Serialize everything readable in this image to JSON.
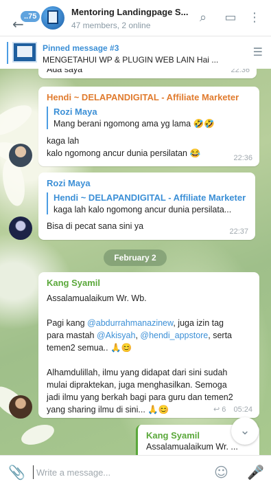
{
  "header": {
    "unread_badge": "..75",
    "title": "Mentoring Landingpage S...",
    "subtitle": "47 members, 2 online"
  },
  "pinned": {
    "title": "Pinned message #3",
    "text": "MENGETAHUI WP & PLUGIN WEB LAIN  Hai ..."
  },
  "messages": [
    {
      "partial_text": "Ada saya",
      "time": "22:36"
    },
    {
      "sender": "Hendi ~ DELAPANDIGITAL - Affiliate Marketer",
      "sender_color": "#e07b2e",
      "quote_name": "Rozi Maya",
      "quote_text": "Mang berani ngomong ama yg lama 🤣🤣",
      "text_line1": "kaga lah",
      "text_line2": "kalo ngomong ancur dunia persilatan 😂",
      "time": "22:36"
    },
    {
      "sender": "Rozi Maya",
      "sender_color": "#3b8fd6",
      "quote_name": "Hendi ~ DELAPANDIGITAL - Affiliate Marketer",
      "quote_text": "kaga lah kalo ngomong ancur dunia persilata...",
      "text": "Bisa di pecat sana sini ya",
      "time": "22:37"
    },
    {
      "sender": "Kang Syamil",
      "sender_color": "#5aa83a",
      "p1": "Assalamualaikum Wr. Wb.",
      "p2_a": "Pagi kang ",
      "p2_link1": "@abdurrahmanazinew",
      "p2_b": ", juga izin tag",
      "p2_c": "para mastah ",
      "p2_link2": "@Akisyah",
      "p2_d": ", ",
      "p2_link3": "@hendi_appstore",
      "p2_e": ", serta",
      "p2_f": "temen2 semua.. 🙏😊",
      "p3_l1": "Alhamdulillah, ilmu yang didapat dari sini sudah",
      "p3_l2": "mulai dipraktekan, juga menghasilkan. Semoga",
      "p3_l3": "jadi ilmu yang berkah bagi para guru dan temen2",
      "p3_l4": "yang sharing ilmu di sini... 🙏😊",
      "replies": "6",
      "time": "05:24"
    },
    {
      "sender": "Kang Syamil",
      "text": "Assalamualaikum Wr. ..."
    }
  ],
  "date_separator": "February 2",
  "composer": {
    "placeholder": "Write a message..."
  },
  "icons": [
    "back-arrow-icon",
    "search-icon",
    "chat-icon",
    "more-vert-icon",
    "unpin-icon",
    "attach-icon",
    "emoji-icon",
    "mic-icon",
    "chevron-down-icon",
    "reply-icon"
  ]
}
